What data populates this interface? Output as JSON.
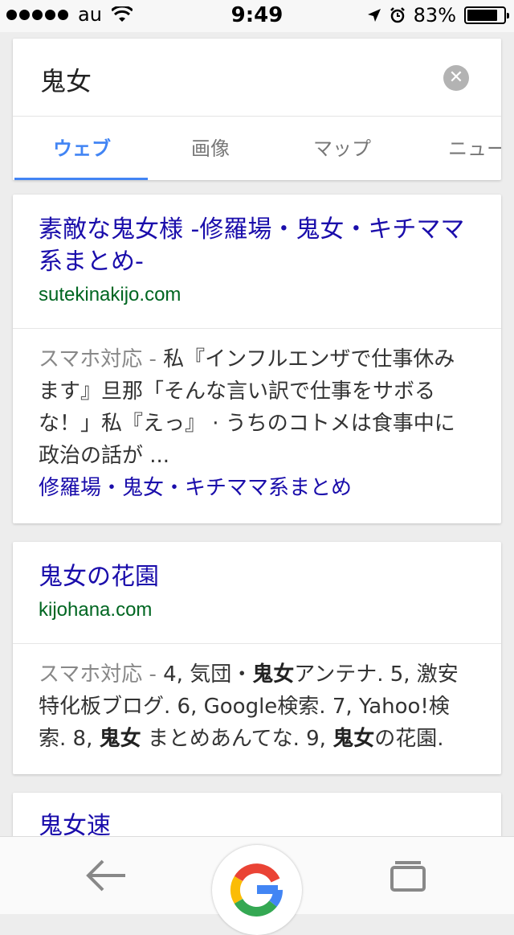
{
  "status_bar": {
    "carrier": "au",
    "time": "9:49",
    "battery_text": "83%",
    "battery_level": 0.83,
    "icons": [
      "signal-dots-icon",
      "wifi-icon",
      "location-arrow-icon",
      "alarm-icon",
      "battery-icon"
    ]
  },
  "search": {
    "query": "鬼女",
    "clear_icon": "close-circle-icon"
  },
  "tabs": [
    {
      "label": "ウェブ",
      "active": true
    },
    {
      "label": "画像",
      "active": false
    },
    {
      "label": "マップ",
      "active": false
    },
    {
      "label": "ニュー",
      "active": false
    }
  ],
  "results": [
    {
      "title": "素敵な鬼女様 -修羅場・鬼女・キチママ系まとめ-",
      "url": "sutekinakijo.com",
      "mobile_tag": "スマホ対応 - ",
      "snippet": "私『インフルエンザで仕事休みます』旦那「そんな言い訳で仕事をサボるな！」私『えっ』 · うちのコトメは食事中に政治の話が ...",
      "sublink": "修羅場・鬼女・キチママ系まとめ"
    },
    {
      "title": "鬼女の花園",
      "url": "kijohana.com",
      "mobile_tag": "スマホ対応 - ",
      "snippet_parts": [
        "4, 気団・",
        "鬼女",
        "アンテナ. 5, 激安特化板ブログ. 6, Google検索. 7, Yahoo!検索. 8, ",
        "鬼女",
        " まとめあんてな. 9, ",
        "鬼女",
        "の花園."
      ]
    },
    {
      "title": "鬼女速"
    }
  ],
  "bottom_bar": {
    "back_icon": "back-arrow-icon",
    "home_icon": "google-g-icon",
    "tabs_icon": "tabs-icon"
  },
  "colors": {
    "accent": "#4285f4",
    "link": "#1a0dab",
    "url": "#006621"
  }
}
